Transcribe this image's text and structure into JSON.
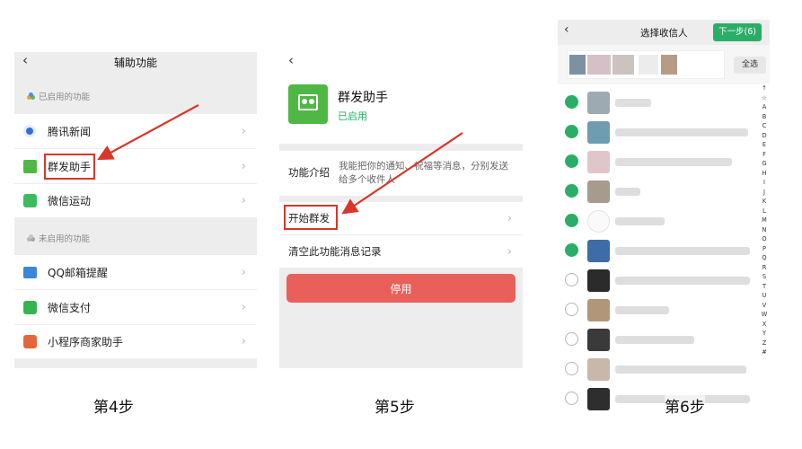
{
  "panel1": {
    "title": "辅助功能",
    "enabled_section": "已启用的功能",
    "enabled_items": [
      {
        "label": "腾讯新闻"
      },
      {
        "label": "群发助手"
      },
      {
        "label": "微信运动"
      }
    ],
    "disabled_section": "未启用的功能",
    "disabled_items": [
      {
        "label": "QQ邮箱提醒"
      },
      {
        "label": "微信支付"
      },
      {
        "label": "小程序商家助手"
      }
    ],
    "step": "第4步"
  },
  "panel2": {
    "app_name": "群发助手",
    "status": "已启用",
    "intro_label": "功能介绍",
    "intro_text": "我能把你的通知、祝福等消息，分别发送给多个收件人",
    "start_label": "开始群发",
    "clear_label": "清空此功能消息记录",
    "disable_button": "停用",
    "step": "第5步"
  },
  "panel3": {
    "title": "选择收信人",
    "next_button": "下一步(6)",
    "select_all": "全选",
    "index_letters": [
      "↑",
      "☆",
      "A",
      "B",
      "C",
      "D",
      "E",
      "F",
      "G",
      "H",
      "I",
      "J",
      "K",
      "L",
      "M",
      "N",
      "O",
      "P",
      "Q",
      "R",
      "S",
      "T",
      "U",
      "V",
      "W",
      "X",
      "Y",
      "Z",
      "#"
    ],
    "contacts": [
      {
        "checked": true
      },
      {
        "checked": true
      },
      {
        "checked": true
      },
      {
        "checked": true
      },
      {
        "checked": true
      },
      {
        "checked": true
      },
      {
        "checked": false
      },
      {
        "checked": false
      },
      {
        "checked": false
      },
      {
        "checked": false
      },
      {
        "checked": false
      }
    ],
    "step": "第6步"
  },
  "colors": {
    "accent_green": "#2aae67",
    "red_annotation": "#d9352a",
    "disable_button": "#e9605a"
  }
}
